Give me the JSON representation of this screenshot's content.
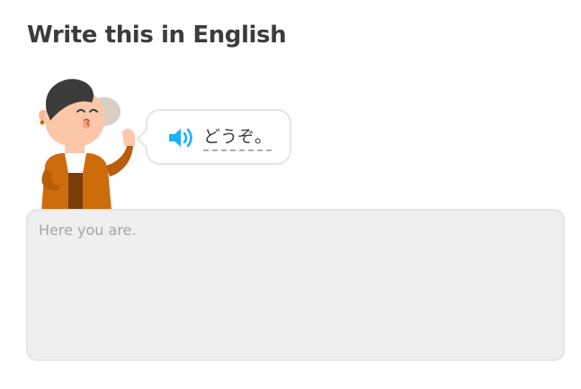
{
  "header": {
    "title": "Write this in English"
  },
  "character": {
    "icon": "character-illustration"
  },
  "prompt": {
    "speaker_icon": "speaker-icon",
    "text": "どうぞ。"
  },
  "answer": {
    "value": "",
    "placeholder": "Here you are."
  },
  "colors": {
    "accent_blue": "#1cb0f6",
    "text": "#3c3c3c",
    "input_bg": "#efefef",
    "border": "#e5e5e5",
    "jacket": "#cd6c0c"
  }
}
